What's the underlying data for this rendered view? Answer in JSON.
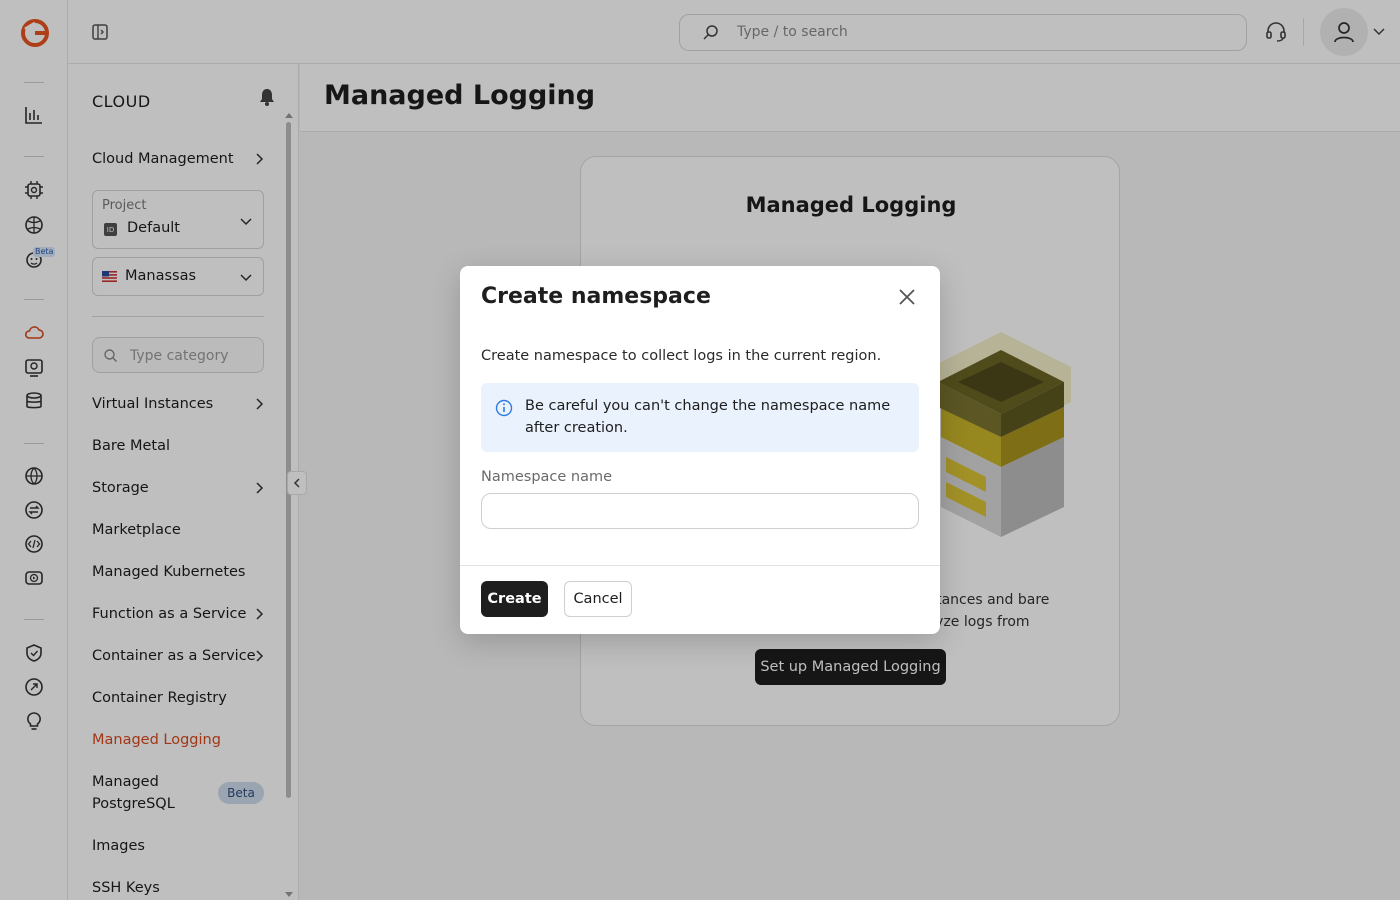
{
  "topbar": {
    "search_placeholder": "Type / to search"
  },
  "rail": {
    "beta_label": "Beta",
    "icons": [
      "logo-icon",
      "analytics-icon",
      "gpu-icon",
      "ai-icon",
      "robot-icon",
      "cloud-icon",
      "dedicated-icon",
      "storage-icon",
      "network-icon",
      "transfer-icon",
      "code-icon",
      "streaming-icon",
      "security-icon",
      "migration-icon",
      "ideas-icon"
    ]
  },
  "sidebar": {
    "title": "CLOUD",
    "cloud_management": "Cloud Management",
    "project": {
      "label": "Project",
      "id_badge": "ID",
      "value": "Default"
    },
    "region": {
      "value": "Manassas"
    },
    "search_placeholder": "Type category",
    "items": [
      {
        "label": "Virtual Instances"
      },
      {
        "label": "Bare Metal"
      },
      {
        "label": "Storage"
      },
      {
        "label": "Marketplace"
      },
      {
        "label": "Managed Kubernetes"
      },
      {
        "label": "Function as a Service"
      },
      {
        "label": "Container as a Service"
      },
      {
        "label": "Container Registry"
      },
      {
        "label": "Managed Logging"
      },
      {
        "label": "Managed PostgreSQL",
        "badge": "Beta"
      },
      {
        "label": "Images"
      },
      {
        "label": "SSH Keys"
      }
    ]
  },
  "main": {
    "page_title": "Managed Logging",
    "card": {
      "title": "Managed Logging",
      "description": "Collect and analyze logs from your virtual instances and bare metal servers. You can view, search and analyze logs from",
      "button": "Set up Managed Logging"
    }
  },
  "modal": {
    "title": "Create namespace",
    "description": "Create namespace to collect logs in the current region.",
    "info": "Be careful you can't change the namespace name after creation.",
    "field_label": "Namespace name",
    "field_value": "",
    "create_label": "Create",
    "cancel_label": "Cancel"
  },
  "colors": {
    "accent": "#d94a1e",
    "info_bg": "#eaf2fd",
    "info_icon": "#2f7de1",
    "dark_button": "#1e1e1e"
  }
}
